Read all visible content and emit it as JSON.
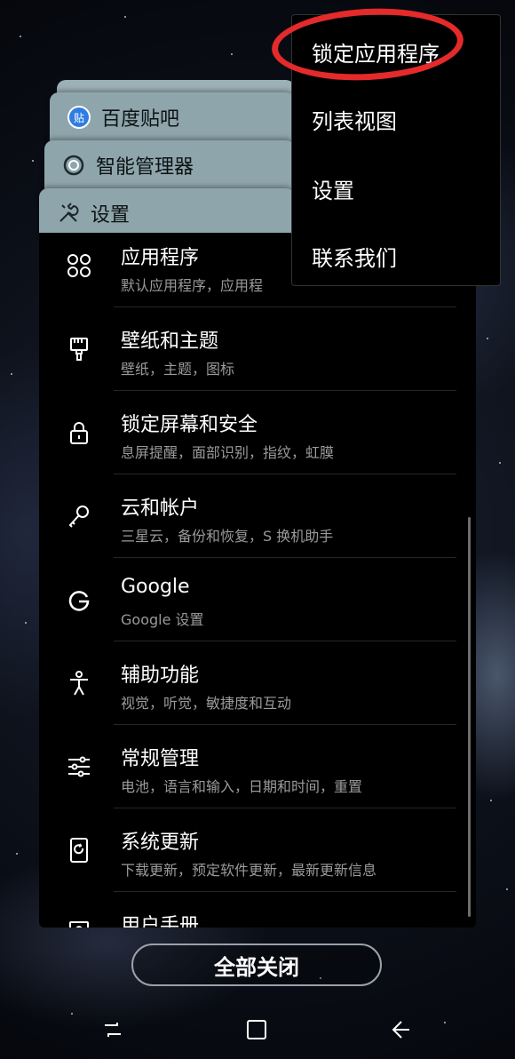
{
  "recent_cards": {
    "baidu": {
      "label": "百度贴吧",
      "icon": "baidu-tieba-icon",
      "icon_badge": "贴"
    },
    "smart_manager": {
      "label": "智能管理器",
      "icon": "smart-manager-icon"
    },
    "settings": {
      "label": "设置",
      "icon": "tools-icon"
    }
  },
  "settings_list": [
    {
      "title": "应用程序",
      "subtitle": "默认应用程序，应用程",
      "icon": "apps-grid-icon"
    },
    {
      "title": "壁纸和主题",
      "subtitle": "壁纸，主题，图标",
      "icon": "paint-brush-icon"
    },
    {
      "title": "锁定屏幕和安全",
      "subtitle": "息屏提醒，面部识别，指纹，虹膜",
      "icon": "lock-icon"
    },
    {
      "title": "云和帐户",
      "subtitle": "三星云，备份和恢复，S 换机助手",
      "icon": "key-icon"
    },
    {
      "title": "Google",
      "subtitle": "Google 设置",
      "icon": "google-icon"
    },
    {
      "title": "辅助功能",
      "subtitle": "视觉，听觉，敏捷度和互动",
      "icon": "accessibility-icon"
    },
    {
      "title": "常规管理",
      "subtitle": "电池，语言和输入，日期和时间，重置",
      "icon": "sliders-icon"
    },
    {
      "title": "系统更新",
      "subtitle": "下载更新，预定软件更新，最新更新信息",
      "icon": "system-update-icon"
    },
    {
      "title": "用户手册",
      "subtitle": "",
      "icon": "user-manual-icon"
    }
  ],
  "popup_menu": {
    "items": [
      "锁定应用程序",
      "列表视图",
      "设置",
      "联系我们"
    ]
  },
  "close_all_label": "全部关闭",
  "navbar": {
    "recent": "recent-apps-icon",
    "home": "home-icon",
    "back": "back-icon"
  },
  "colors": {
    "highlight": "#e42a2a",
    "card_tab": "#8ea5ab"
  }
}
